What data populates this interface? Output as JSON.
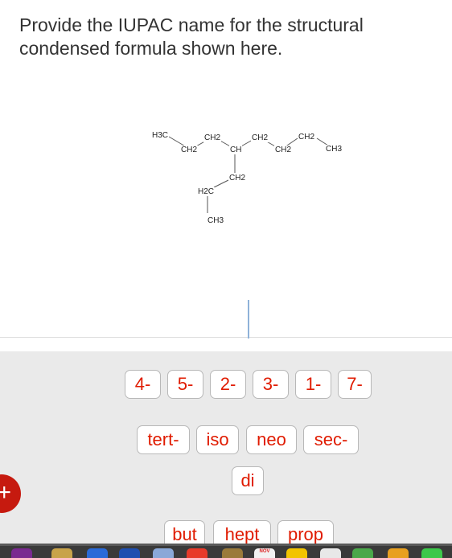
{
  "question": {
    "text": "Provide the IUPAC name for the structural condensed formula shown here."
  },
  "structure": {
    "atoms": {
      "a1": "H3C",
      "a2": "CH2",
      "a3": "CH2",
      "a4": "CH",
      "a5": "CH2",
      "a6": "CH2",
      "a7": "CH2",
      "a8": "CH3",
      "a9": "CH2",
      "a10": "H2C",
      "a11": "CH3"
    }
  },
  "tiles": {
    "row1": [
      "4-",
      "5-",
      "2-",
      "3-",
      "1-",
      "7-"
    ],
    "row2": [
      "tert-",
      "iso",
      "neo",
      "sec-"
    ],
    "row3": [
      "di"
    ],
    "row4": [
      "but",
      "hept",
      "prop"
    ]
  },
  "add_button": {
    "label": "+"
  },
  "colors": {
    "tile_text": "#e01b00",
    "tile_area_bg": "#eaeaea",
    "add_button": "#c61a0f"
  },
  "taskbar": {
    "calendar_label": "NOV"
  }
}
